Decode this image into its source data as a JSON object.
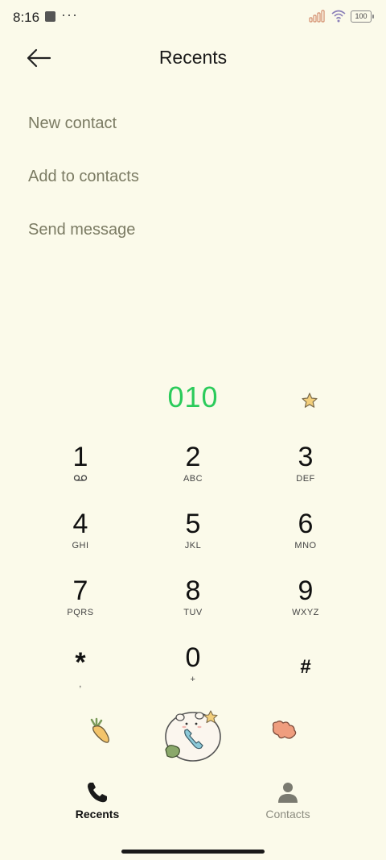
{
  "status_bar": {
    "time": "8:16",
    "dots": "···",
    "battery": "100"
  },
  "header": {
    "title": "Recents",
    "back_icon": "arrow-left-icon"
  },
  "menu": {
    "items": [
      "New contact",
      "Add to contacts",
      "Send message"
    ]
  },
  "dialer": {
    "number": "010",
    "number_color": "#2bcb5b"
  },
  "keypad": {
    "keys": [
      {
        "digit": "1",
        "letters": ""
      },
      {
        "digit": "2",
        "letters": "ABC"
      },
      {
        "digit": "3",
        "letters": "DEF"
      },
      {
        "digit": "4",
        "letters": "GHI"
      },
      {
        "digit": "5",
        "letters": "JKL"
      },
      {
        "digit": "6",
        "letters": "MNO"
      },
      {
        "digit": "7",
        "letters": "PQRS"
      },
      {
        "digit": "8",
        "letters": "TUV"
      },
      {
        "digit": "9",
        "letters": "WXYZ"
      },
      {
        "digit": "*",
        "letters": ","
      },
      {
        "digit": "0",
        "letters": "+"
      },
      {
        "digit": "#",
        "letters": ""
      }
    ]
  },
  "nav": {
    "recents_label": "Recents",
    "contacts_label": "Contacts"
  },
  "colors": {
    "background": "#fbfaea",
    "accent_green": "#2bcb5b",
    "menu_text": "#7b7b63"
  }
}
